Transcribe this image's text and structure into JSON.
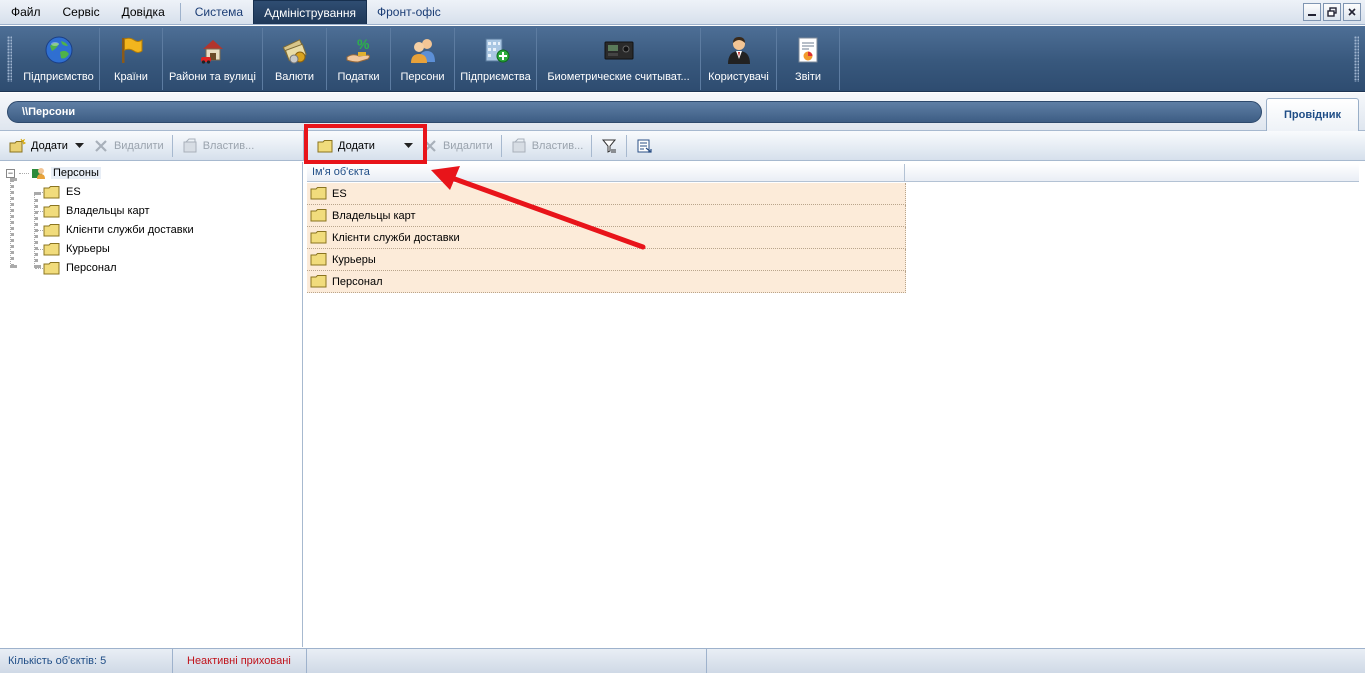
{
  "menu": {
    "items": [
      "Файл",
      "Сервіс",
      "Довідка"
    ],
    "tabs": [
      "Система",
      "Адміністрування",
      "Фронт-офіс"
    ],
    "active_tab": "Адміністрування"
  },
  "ribbon": {
    "buttons": [
      {
        "label": "Підприємство",
        "icon": "globe-icon"
      },
      {
        "label": "Країни",
        "icon": "flag-icon"
      },
      {
        "label": "Райони та вулиці",
        "icon": "house-icon"
      },
      {
        "label": "Валюти",
        "icon": "money-icon"
      },
      {
        "label": "Податки",
        "icon": "tax-icon"
      },
      {
        "label": "Персони",
        "icon": "persons-icon"
      },
      {
        "label": "Підприємства",
        "icon": "enterprises-icon"
      },
      {
        "label": "Биометрические считыват...",
        "icon": "biometric-reader-icon"
      },
      {
        "label": "Користувачі",
        "icon": "user-icon"
      },
      {
        "label": "Звіти",
        "icon": "report-icon"
      }
    ]
  },
  "address": {
    "path": "\\\\Персони",
    "explorer_tab": "Провідник"
  },
  "left_toolbar": {
    "add": "Додати",
    "delete": "Видалити",
    "properties": "Властив..."
  },
  "right_toolbar": {
    "add": "Додати",
    "delete": "Видалити",
    "properties": "Властив..."
  },
  "tree": {
    "root": "Персоны",
    "children": [
      "ES",
      "Владельцы карт",
      "Клієнти служби доставки",
      "Курьеры",
      "Персонал"
    ]
  },
  "list": {
    "column_name": "Ім'я об'єкта",
    "rows": [
      "ES",
      "Владельцы карт",
      "Клієнти служби доставки",
      "Курьеры",
      "Персонал"
    ]
  },
  "status": {
    "count": "Кількість об'єктів: 5",
    "inactive": "Неактивні приховані"
  },
  "colors": {
    "highlight": "#e8141a",
    "ribbon": "#3b5b80",
    "row": "#fcebd9",
    "status_warning": "#c0121a"
  }
}
